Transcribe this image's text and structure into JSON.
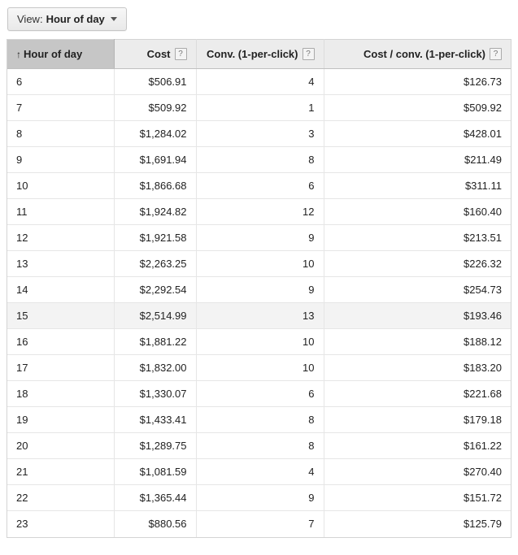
{
  "toolbar": {
    "view_label": "View:",
    "view_value": "Hour of day",
    "caret_icon": "chevron-down-icon"
  },
  "table": {
    "sort_arrow": "↑",
    "sort_column": "Hour of day",
    "sort_direction": "ascending",
    "help_icon_glyph": "?",
    "columns": [
      {
        "key": "hour",
        "label": "Hour of day",
        "align": "left",
        "sorted": true,
        "help": false
      },
      {
        "key": "cost",
        "label": "Cost",
        "align": "right",
        "sorted": false,
        "help": true
      },
      {
        "key": "conv",
        "label": "Conv. (1-per-click)",
        "align": "right",
        "sorted": false,
        "help": true
      },
      {
        "key": "cpc",
        "label": "Cost / conv. (1-per-click)",
        "align": "right",
        "sorted": false,
        "help": true
      }
    ],
    "highlight_row_index": 9,
    "rows": [
      {
        "hour": "6",
        "cost": "$506.91",
        "conv": "4",
        "cpc": "$126.73"
      },
      {
        "hour": "7",
        "cost": "$509.92",
        "conv": "1",
        "cpc": "$509.92"
      },
      {
        "hour": "8",
        "cost": "$1,284.02",
        "conv": "3",
        "cpc": "$428.01"
      },
      {
        "hour": "9",
        "cost": "$1,691.94",
        "conv": "8",
        "cpc": "$211.49"
      },
      {
        "hour": "10",
        "cost": "$1,866.68",
        "conv": "6",
        "cpc": "$311.11"
      },
      {
        "hour": "11",
        "cost": "$1,924.82",
        "conv": "12",
        "cpc": "$160.40"
      },
      {
        "hour": "12",
        "cost": "$1,921.58",
        "conv": "9",
        "cpc": "$213.51"
      },
      {
        "hour": "13",
        "cost": "$2,263.25",
        "conv": "10",
        "cpc": "$226.32"
      },
      {
        "hour": "14",
        "cost": "$2,292.54",
        "conv": "9",
        "cpc": "$254.73"
      },
      {
        "hour": "15",
        "cost": "$2,514.99",
        "conv": "13",
        "cpc": "$193.46"
      },
      {
        "hour": "16",
        "cost": "$1,881.22",
        "conv": "10",
        "cpc": "$188.12"
      },
      {
        "hour": "17",
        "cost": "$1,832.00",
        "conv": "10",
        "cpc": "$183.20"
      },
      {
        "hour": "18",
        "cost": "$1,330.07",
        "conv": "6",
        "cpc": "$221.68"
      },
      {
        "hour": "19",
        "cost": "$1,433.41",
        "conv": "8",
        "cpc": "$179.18"
      },
      {
        "hour": "20",
        "cost": "$1,289.75",
        "conv": "8",
        "cpc": "$161.22"
      },
      {
        "hour": "21",
        "cost": "$1,081.59",
        "conv": "4",
        "cpc": "$270.40"
      },
      {
        "hour": "22",
        "cost": "$1,365.44",
        "conv": "9",
        "cpc": "$151.72"
      },
      {
        "hour": "23",
        "cost": "$880.56",
        "conv": "7",
        "cpc": "$125.79"
      }
    ]
  },
  "colors": {
    "sorted_header_bg": "#c6c6c6",
    "header_bg": "#ececec",
    "row_highlight_bg": "#f3f3f3",
    "border": "#d4d4d4",
    "text": "#222222"
  }
}
